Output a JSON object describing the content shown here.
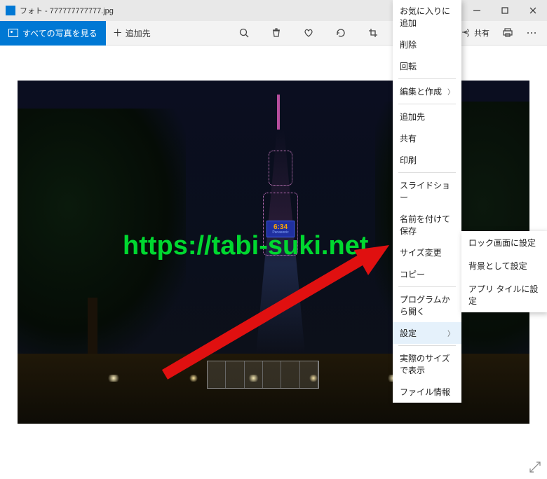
{
  "titlebar": {
    "title": "フォト - 777777777777.jpg"
  },
  "toolbar": {
    "view_all_label": "すべての写真を見る",
    "add_to_label": "追加先",
    "share_label": "共有"
  },
  "tower": {
    "time": "6:34",
    "brand": "Panasonic"
  },
  "watermark": "https://tabi-suki.net",
  "context_menu": {
    "favorite": "お気に入りに追加",
    "delete": "削除",
    "rotate": "回転",
    "edit_create": "編集と作成",
    "add_to": "追加先",
    "share": "共有",
    "print": "印刷",
    "slideshow": "スライドショー",
    "save_as": "名前を付けて保存",
    "resize": "サイズ変更",
    "copy": "コピー",
    "open_with": "プログラムから開く",
    "settings": "設定",
    "actual_size": "実際のサイズで表示",
    "file_info": "ファイル情報"
  },
  "submenu": {
    "lock_screen": "ロック画面に設定",
    "background": "背景として設定",
    "app_tile": "アプリ タイルに設定"
  }
}
